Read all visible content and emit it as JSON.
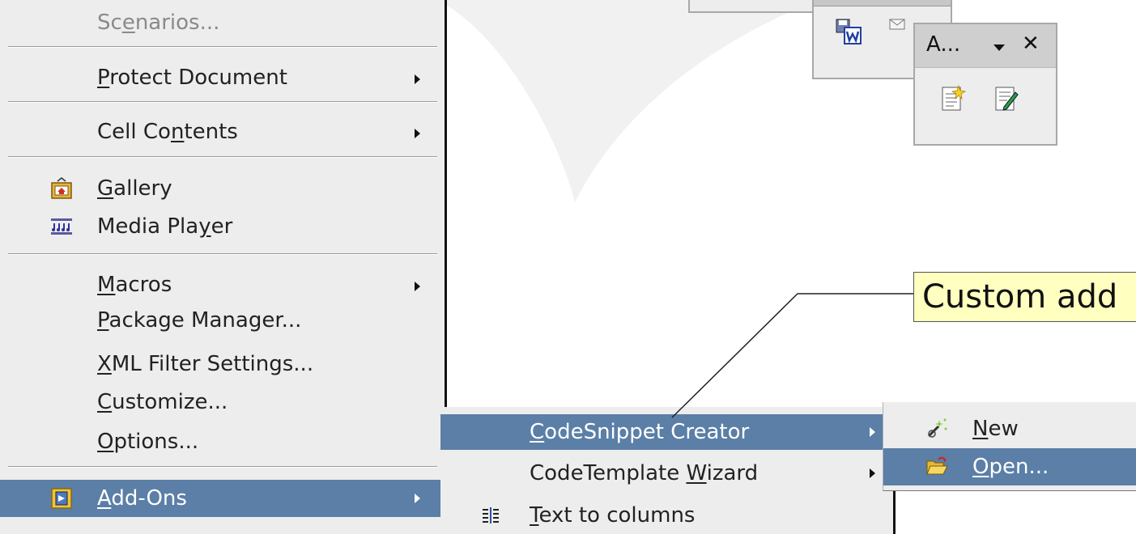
{
  "main_menu": {
    "items": [
      {
        "label": "Scenarios...",
        "disabled": true
      },
      {
        "label": "Protect Document",
        "submenu": true
      },
      {
        "label": "Cell Contents",
        "submenu": true
      },
      {
        "label": "Gallery",
        "icon": "gallery-icon"
      },
      {
        "label": "Media Player",
        "icon": "media-player-icon"
      },
      {
        "label": "Macros",
        "submenu": true
      },
      {
        "label": "Package Manager..."
      },
      {
        "label": "XML Filter Settings..."
      },
      {
        "label": "Customize..."
      },
      {
        "label": "Options..."
      },
      {
        "label": "Add-Ons",
        "submenu": true,
        "highlighted": true,
        "icon": "add-ons-icon"
      }
    ]
  },
  "addons_menu": {
    "items": [
      {
        "label": "CodeSnippet Creator",
        "submenu": true,
        "highlighted": true
      },
      {
        "label": "CodeTemplate Wizard",
        "submenu": true
      },
      {
        "label": "Text to columns",
        "icon": "text-to-columns-icon"
      }
    ]
  },
  "snippet_menu": {
    "items": [
      {
        "label": "New",
        "icon": "new-wand-icon"
      },
      {
        "label": "Open...",
        "icon": "open-folder-icon",
        "highlighted": true
      }
    ]
  },
  "addons_toolbar": {
    "title": "A...",
    "close": "✕"
  },
  "callout": {
    "text": "Custom add"
  },
  "colors": {
    "menu_bg": "#ededed",
    "highlight": "#5b7fa6",
    "callout_bg": "#ffffc0"
  }
}
